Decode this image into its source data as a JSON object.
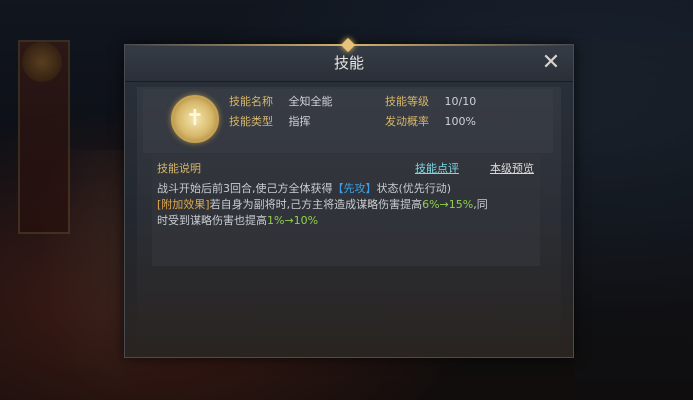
{
  "dialog": {
    "title": "技能",
    "close_label": "✕"
  },
  "skill": {
    "name_label": "技能名称",
    "name": "全知全能",
    "type_label": "技能类型",
    "type": "指挥",
    "level_label": "技能等级",
    "level": "10/10",
    "rate_label": "发动概率",
    "rate": "100%",
    "icon": "winged-figure-icon"
  },
  "description": {
    "header": "技能说明",
    "review_tab": "技能点评",
    "preview_tab": "本级预览",
    "line1_prefix": "战斗开始后前3回合,使己方全体获得",
    "line1_keyword": "【先攻】",
    "line1_suffix": "状态(优先行动)",
    "line2_bonus": "[附加效果]",
    "line2_text": "若自身为副将时,己方主将造成谋略伤害提高",
    "line2_value": "6%→15%",
    "line2_tail": ",同",
    "line3_text": "时受到谋略伤害也提高",
    "line3_value": "1%→10%"
  },
  "colors": {
    "gold_label": "#d6b66a",
    "keyword_blue": "#3aa0e8",
    "bonus_orange": "#e2a84a",
    "value_green": "#8fd14a",
    "link_cyan": "#7fd6e0"
  }
}
